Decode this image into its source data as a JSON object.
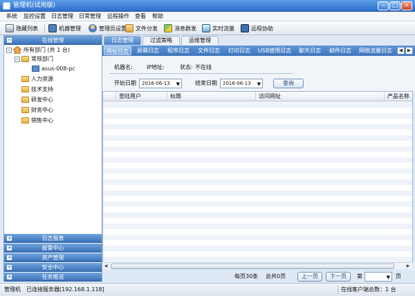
{
  "window": {
    "title": "管理机(试用版)"
  },
  "menu": [
    "系统",
    "监控设置",
    "日志管理",
    "日常管理",
    "远程操作",
    "查看",
    "帮助"
  ],
  "toolbar": [
    "隐藏列表",
    "机器管理",
    "管理员设置",
    "文件分发",
    "消息群发",
    "实时流量",
    "远程协助"
  ],
  "left_panel": {
    "header": "在线管理",
    "tree": {
      "root": "所有部门 (共 1 台)",
      "departments": [
        "常规部门",
        "人力资源",
        "技术支持",
        "研发中心",
        "财务中心",
        "销售中心"
      ],
      "computer": "asus-008-pc"
    },
    "bottom_sections": [
      "日志报表",
      "报警中心",
      "资产管理",
      "安全中心",
      "任务推送"
    ]
  },
  "tabs_main": [
    "日志管理",
    "过滤策略",
    "运维管理"
  ],
  "tabs_logs": [
    "网址日志",
    "屏幕日志",
    "程序日志",
    "文件日志",
    "打印日志",
    "USB使用日志",
    "聊天日志",
    "邮件日志",
    "网络流量日志"
  ],
  "info": {
    "machine_label": "机器名:",
    "ip_label": "IP地址:",
    "status_label": "状态:",
    "status_value": "不在线",
    "start_label": "开始日期",
    "start_value": "2016-06-13",
    "end_label": "结束日期",
    "end_value": "2016-06-13",
    "query_button": "查询"
  },
  "grid": {
    "columns": [
      "登陆用户",
      "标题",
      "访问网址",
      "产品名称"
    ]
  },
  "pager": {
    "per_page": "每页30条",
    "total": "总共0页",
    "prev": "上一页",
    "next": "下一页",
    "page_prefix": "第",
    "page_suffix": "页"
  },
  "status": {
    "role": "管理机",
    "server": "已连接服务器[192.168.1.118]",
    "clients": "在线客户端总数：1 台"
  }
}
